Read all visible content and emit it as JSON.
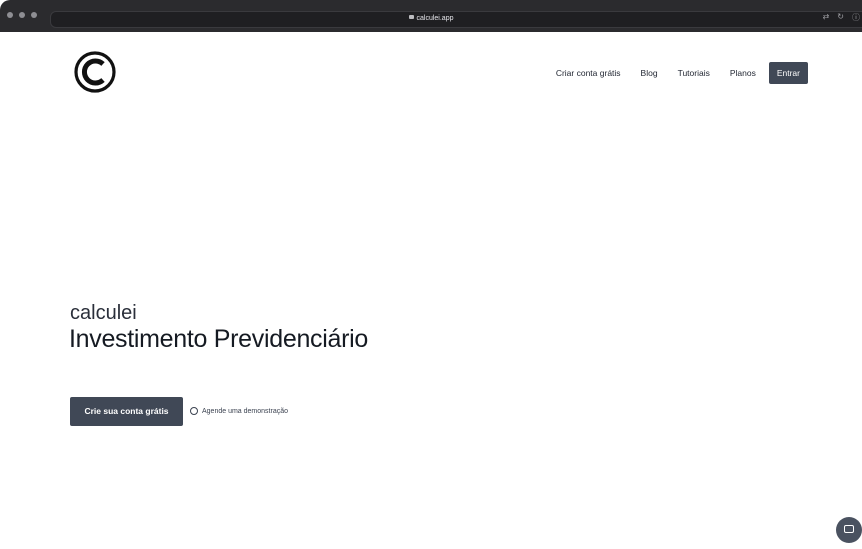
{
  "browser": {
    "url": "calculei.app",
    "right_icons": [
      "translate-icon",
      "reload-icon",
      "info-icon"
    ]
  },
  "nav": {
    "items": [
      "Criar conta grátis",
      "Blog",
      "Tutoriais",
      "Planos"
    ],
    "login": "Entrar"
  },
  "hero": {
    "brand": "calculei",
    "title": "Investimento Previdenciário",
    "cta": "Crie sua conta grátis",
    "demo": "Agende uma demonstração"
  },
  "colors": {
    "primary": "#404856",
    "chrome": "#2b2b2e"
  }
}
